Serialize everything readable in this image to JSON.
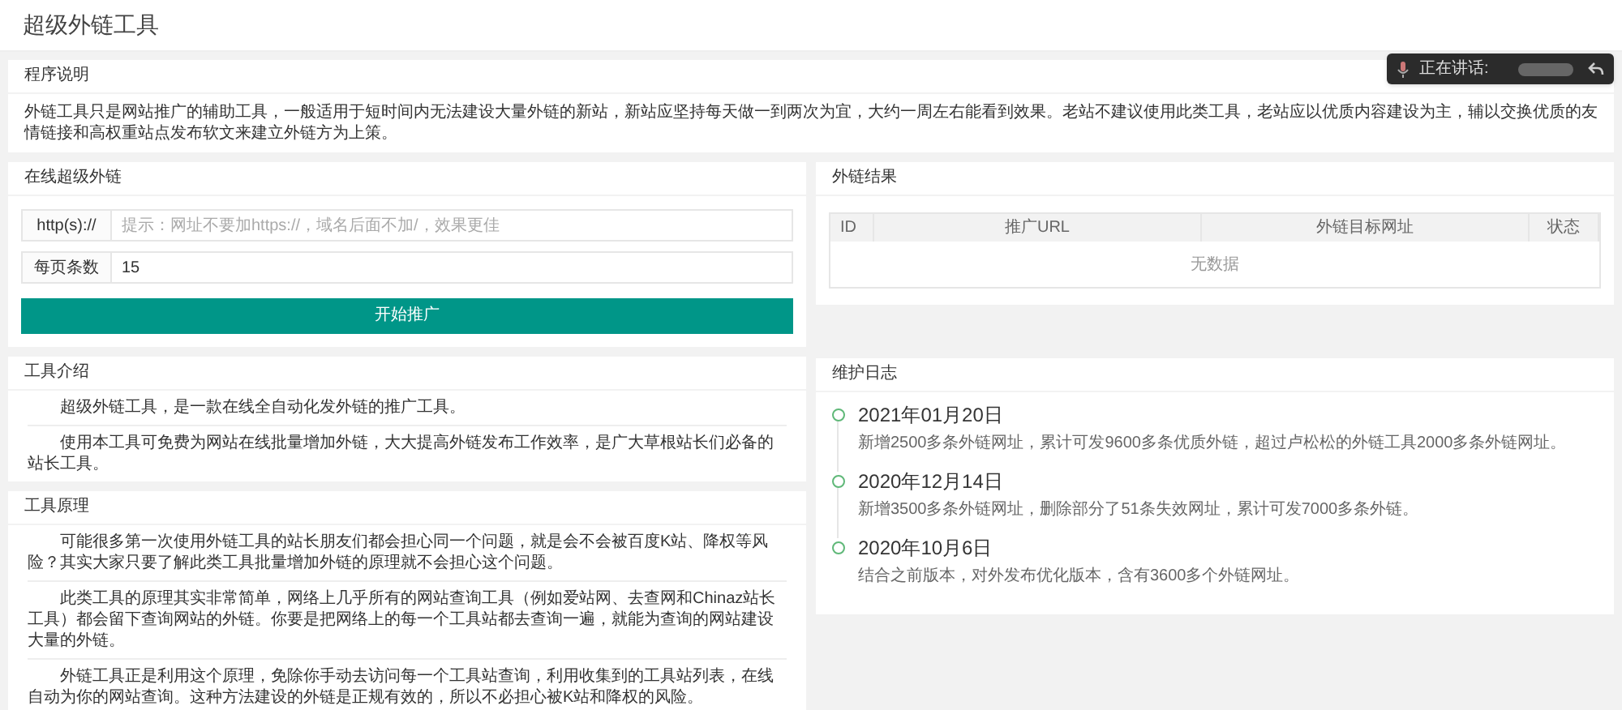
{
  "page_title": "超级外链工具",
  "speaking_overlay": {
    "label": "正在讲话:"
  },
  "notice": {
    "title": "程序说明",
    "text": "外链工具只是网站推广的辅助工具，一般适用于短时间内无法建设大量外链的新站，新站应坚持每天做一到两次为宜，大约一周左右能看到效果。老站不建议使用此类工具，老站应以优质内容建设为主，辅以交换优质的友情链接和高权重站点发布软文来建立外链方为上策。"
  },
  "link_form": {
    "title": "在线超级外链",
    "fields": [
      {
        "label": "http(s)://",
        "placeholder": "提示：网址不要加https://，域名后面不加/，效果更佳"
      },
      {
        "label": "每页条数",
        "value": "15"
      }
    ],
    "button": "开始推广"
  },
  "results": {
    "title": "外链结果",
    "columns": [
      "ID",
      "推广URL",
      "外链目标网址",
      "状态"
    ],
    "empty_text": "无数据"
  },
  "intro": {
    "title": "工具介绍",
    "paragraphs": [
      "超级外链工具，是一款在线全自动化发外链的推广工具。",
      "使用本工具可免费为网站在线批量增加外链，大大提高外链发布工作效率，是广大草根站长们必备的站长工具。"
    ]
  },
  "principle": {
    "title": "工具原理",
    "paragraphs": [
      "可能很多第一次使用外链工具的站长朋友们都会担心同一个问题，就是会不会被百度K站、降权等风险？其实大家只要了解此类工具批量增加外链的原理就不会担心这个问题。",
      "此类工具的原理其实非常简单，网络上几乎所有的网站查询工具（例如爱站网、去查网和Chinaz站长工具）都会留下查询网站的外链。你要是把网络上的每一个工具站都去查询一遍，就能为查询的网站建设大量的外链。",
      "外链工具正是利用这个原理，免除你手动去访问每一个工具站查询，利用收集到的工具站列表，在线自动为你的网站查询。这种方法建设的外链是正规有效的，所以不必担心被K站和降权的风险。"
    ]
  },
  "changelog": {
    "title": "维护日志",
    "entries": [
      {
        "date": "2021年01月20日",
        "text": "新增2500多条外链网址，累计可发9600多条优质外链，超过卢松松的外链工具2000多条外链网址。"
      },
      {
        "date": "2020年12月14日",
        "text": "新增3500多条外链网址，删除部分了51条失效网址，累计可发7000多条外链。"
      },
      {
        "date": "2020年10月6日",
        "text": "结合之前版本，对外发布优化版本，含有3600多个外链网址。"
      }
    ]
  }
}
